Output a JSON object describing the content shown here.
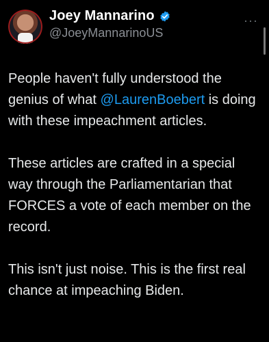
{
  "tweet": {
    "display_name": "Joey Mannarino",
    "handle": "@JoeyMannarinoUS",
    "more_label": "···",
    "para1_before": "People haven't fully understood the genius of what ",
    "mention": "@LaurenBoebert",
    "para1_after": " is doing with these impeachment articles.",
    "para2": "These articles are crafted in a special way through the Parliamentarian that FORCES a vote of each member on the record.",
    "para3": "This isn't just noise. This is the first real chance at impeaching Biden."
  },
  "icons": {
    "verified": "verified-badge-icon",
    "more": "more-icon"
  },
  "colors": {
    "background": "#000000",
    "text": "#e7e9ea",
    "handle": "#8b8f95",
    "link": "#1d9bf0"
  }
}
